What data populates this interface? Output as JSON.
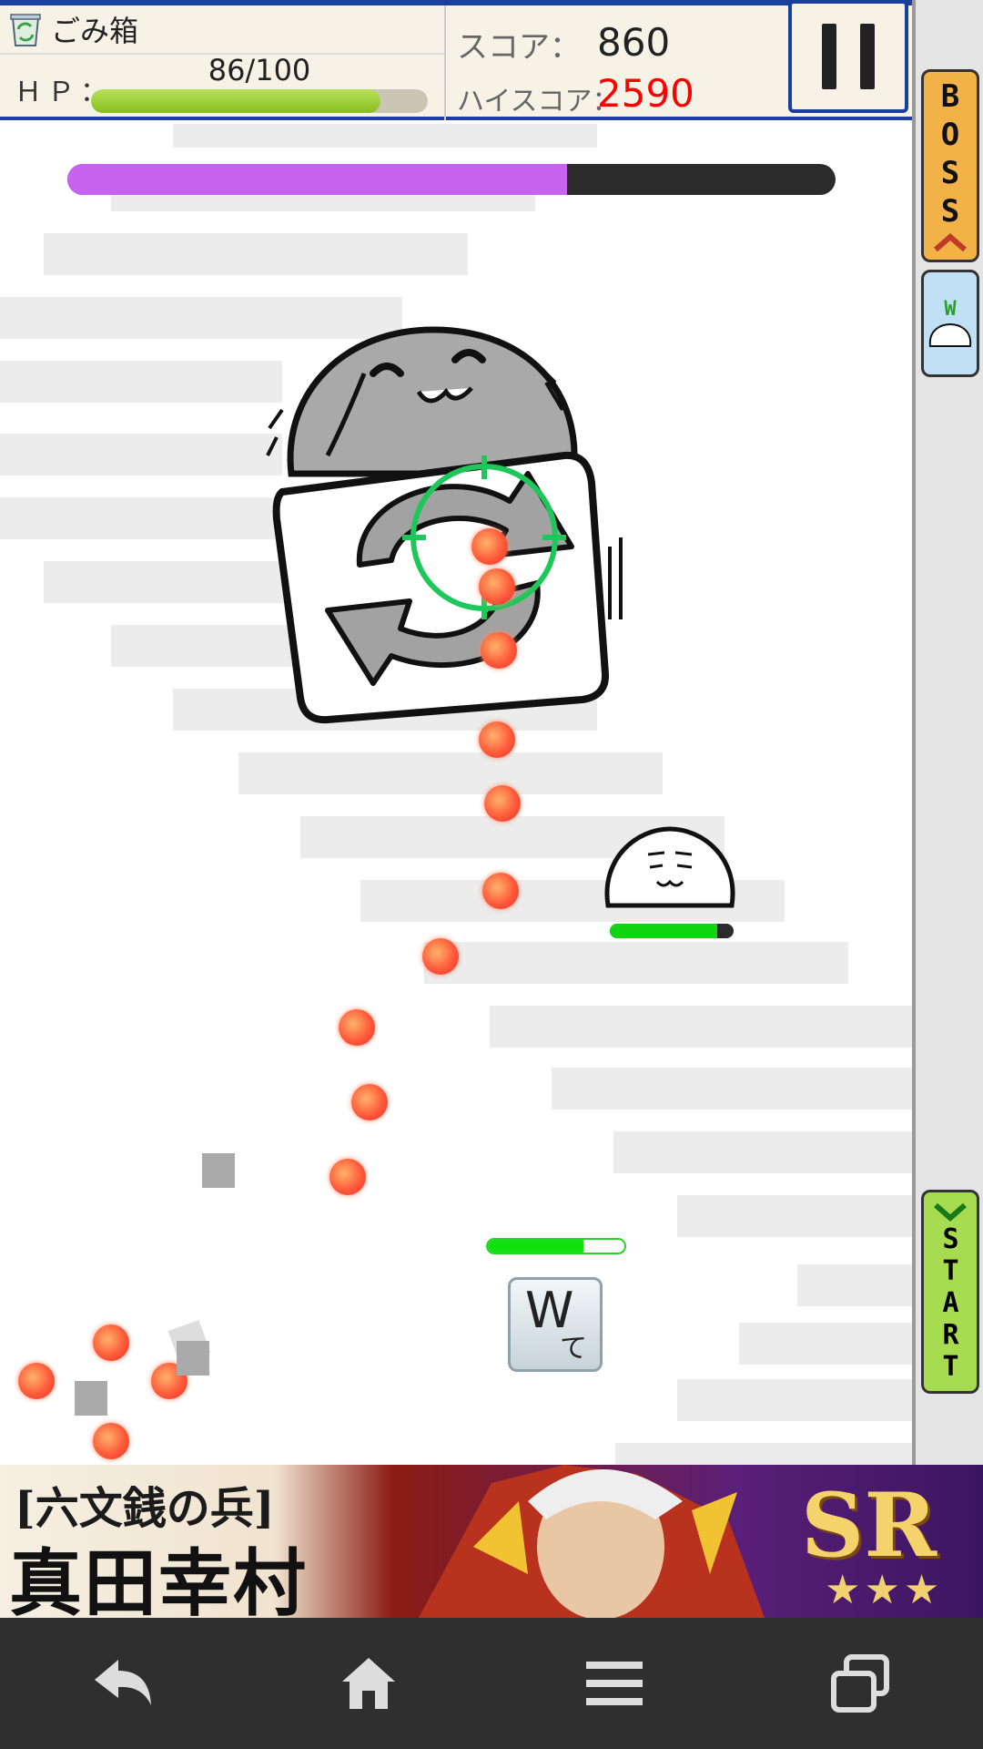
{
  "hud": {
    "stage_name": "ごみ箱",
    "hp_label": "ＨＰ：",
    "hp_value": "86/100",
    "hp_fraction": 0.86,
    "score_label": "スコア：",
    "score": "860",
    "hiscore_label": "ハイスコア：",
    "hiscore": "2590"
  },
  "boss": {
    "hp_fraction": 0.65,
    "bar_color": "#c764ef"
  },
  "player": {
    "key_letter": "W",
    "key_kana": "て",
    "hp_fraction": 0.7
  },
  "enemy": {
    "hp_fraction": 0.87
  },
  "side_rail": {
    "boss_label": "BOSS",
    "start_label": "START",
    "www_label": "W"
  },
  "ad": {
    "line1": "[六文銭の兵]",
    "line2": "真田幸村",
    "rank": "SR",
    "stars": "★★★"
  },
  "colors": {
    "hud_border": "#1a3f9c",
    "hiscore": "#ff0000",
    "hp_green": "#86c020"
  }
}
